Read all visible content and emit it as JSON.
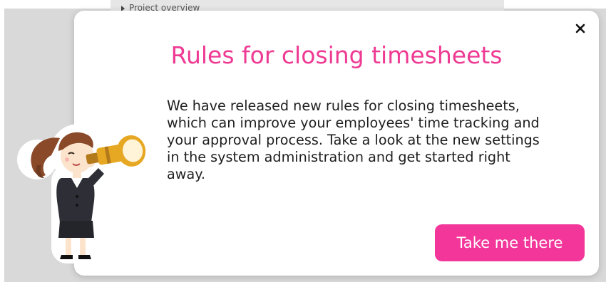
{
  "background": {
    "nav_item_label": "Project overview"
  },
  "modal": {
    "title": "Rules for closing timesheets",
    "body": "We have released new rules for closing timesheets, which can improve your employees' time tracking and your approval process. Take a look at the new settings in the system administration and get started right away.",
    "cta_label": "Take me there",
    "close_icon": "close-icon",
    "illustration": "woman-with-spyglass"
  },
  "colors": {
    "accent": "#f2369a",
    "title": "#ee3a93"
  }
}
